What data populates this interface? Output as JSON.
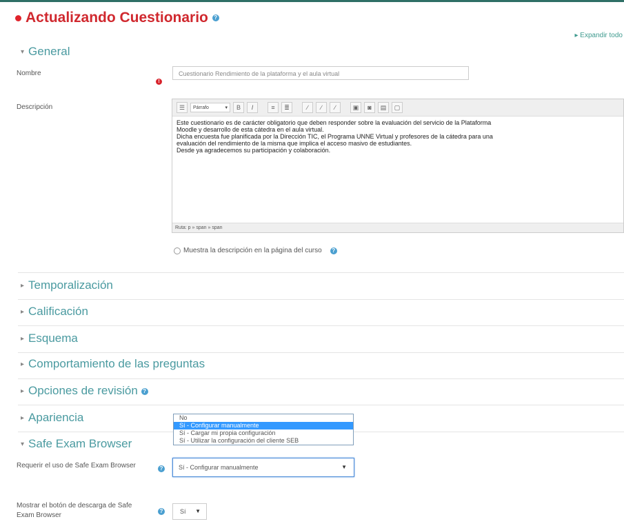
{
  "page": {
    "title": "Actualizando Cuestionario",
    "expand_all": "▸ Expandir todo"
  },
  "general": {
    "heading": "General",
    "name_label": "Nombre",
    "name_value": "Cuestionario Rendimiento de la plataforma y el aula virtual",
    "description_label": "Descripción",
    "editor": {
      "font_select": "Párrafo",
      "content_lines": [
        "Este cuestionario es de carácter obligatorio que deben responder sobre la evaluación del servicio de la Plataforma",
        "Moodle y desarrollo de esta cátedra en el aula virtual.",
        "Dicha encuesta fue planificada por la Dirección TIC, el Programa UNNE Virtual y profesores de la cátedra para una",
        "evaluación del rendimiento de la misma que implica el acceso masivo de estudiantes.",
        "Desde ya agradecemos su participación y colaboración."
      ],
      "status_path": "Ruta: p » span » span"
    },
    "show_description_label": "Muestra la descripción en la página del curso"
  },
  "sections": {
    "timing": "Temporalización",
    "grade": "Calificación",
    "layout": "Esquema",
    "question_behaviour": "Comportamiento de las preguntas",
    "review_options": "Opciones de revisión",
    "appearance": "Apariencia",
    "seb": "Safe Exam Browser"
  },
  "seb": {
    "require_label": "Requerir el uso de Safe Exam Browser",
    "require_options": [
      "No",
      "Sí - Configurar manualmente",
      "Sí - Cargar mi propia configuración",
      "Sí - Utilizar la configuración del cliente SEB"
    ],
    "require_value": "Sí - Configurar manualmente",
    "download_label": "Mostrar el botón de descarga de Safe Exam Browser",
    "download_value": "Sí"
  }
}
